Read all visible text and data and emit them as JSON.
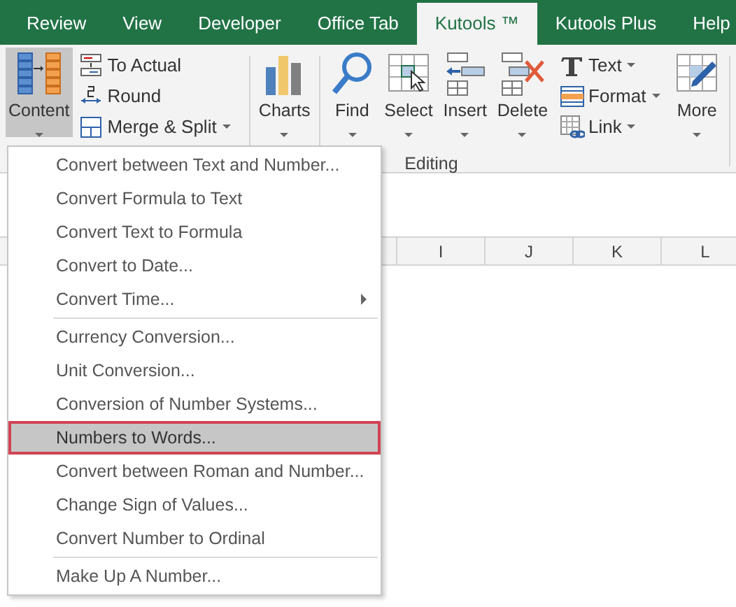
{
  "tabs": [
    {
      "label": "Review",
      "selected": false
    },
    {
      "label": "View",
      "selected": false
    },
    {
      "label": "Developer",
      "selected": false
    },
    {
      "label": "Office Tab",
      "selected": false
    },
    {
      "label": "Kutools ™",
      "selected": true
    },
    {
      "label": "Kutools Plus",
      "selected": false
    },
    {
      "label": "Help",
      "selected": false
    }
  ],
  "ribbon": {
    "content_button": {
      "label": "Content",
      "pressed": true
    },
    "convert_buttons": [
      {
        "label": "To Actual",
        "dropdown": false
      },
      {
        "label": "Round",
        "dropdown": false
      },
      {
        "label": "Merge & Split",
        "dropdown": true
      }
    ],
    "charts_button": "Charts",
    "editing_group": {
      "label": "Editing",
      "large_buttons": [
        "Find",
        "Select",
        "Insert",
        "Delete"
      ],
      "small_buttons": [
        {
          "label": "Text",
          "dropdown": true
        },
        {
          "label": "Format",
          "dropdown": true
        },
        {
          "label": "Link",
          "dropdown": true
        }
      ]
    },
    "more_button": "More"
  },
  "sheet": {
    "column_headers": [
      "I",
      "J",
      "K",
      "L"
    ]
  },
  "menu": {
    "sections": [
      [
        {
          "label": "Convert between Text and Number...",
          "selected": false,
          "has_submenu": false
        },
        {
          "label": "Convert Formula to Text",
          "selected": false,
          "has_submenu": false
        },
        {
          "label": "Convert Text to Formula",
          "selected": false,
          "has_submenu": false
        },
        {
          "label": "Convert to Date...",
          "selected": false,
          "has_submenu": false
        },
        {
          "label": "Convert Time...",
          "selected": false,
          "has_submenu": true
        }
      ],
      [
        {
          "label": "Currency Conversion...",
          "selected": false,
          "has_submenu": false
        },
        {
          "label": "Unit Conversion...",
          "selected": false,
          "has_submenu": false
        },
        {
          "label": "Conversion of Number Systems...",
          "selected": false,
          "has_submenu": false
        },
        {
          "label": "Numbers to Words...",
          "selected": true,
          "has_submenu": false
        },
        {
          "label": "Convert between Roman and Number...",
          "selected": false,
          "has_submenu": false
        },
        {
          "label": "Change Sign of Values...",
          "selected": false,
          "has_submenu": false
        },
        {
          "label": "Convert Number to Ordinal",
          "selected": false,
          "has_submenu": false
        }
      ],
      [
        {
          "label": "Make Up A Number...",
          "selected": false,
          "has_submenu": false
        }
      ]
    ]
  }
}
